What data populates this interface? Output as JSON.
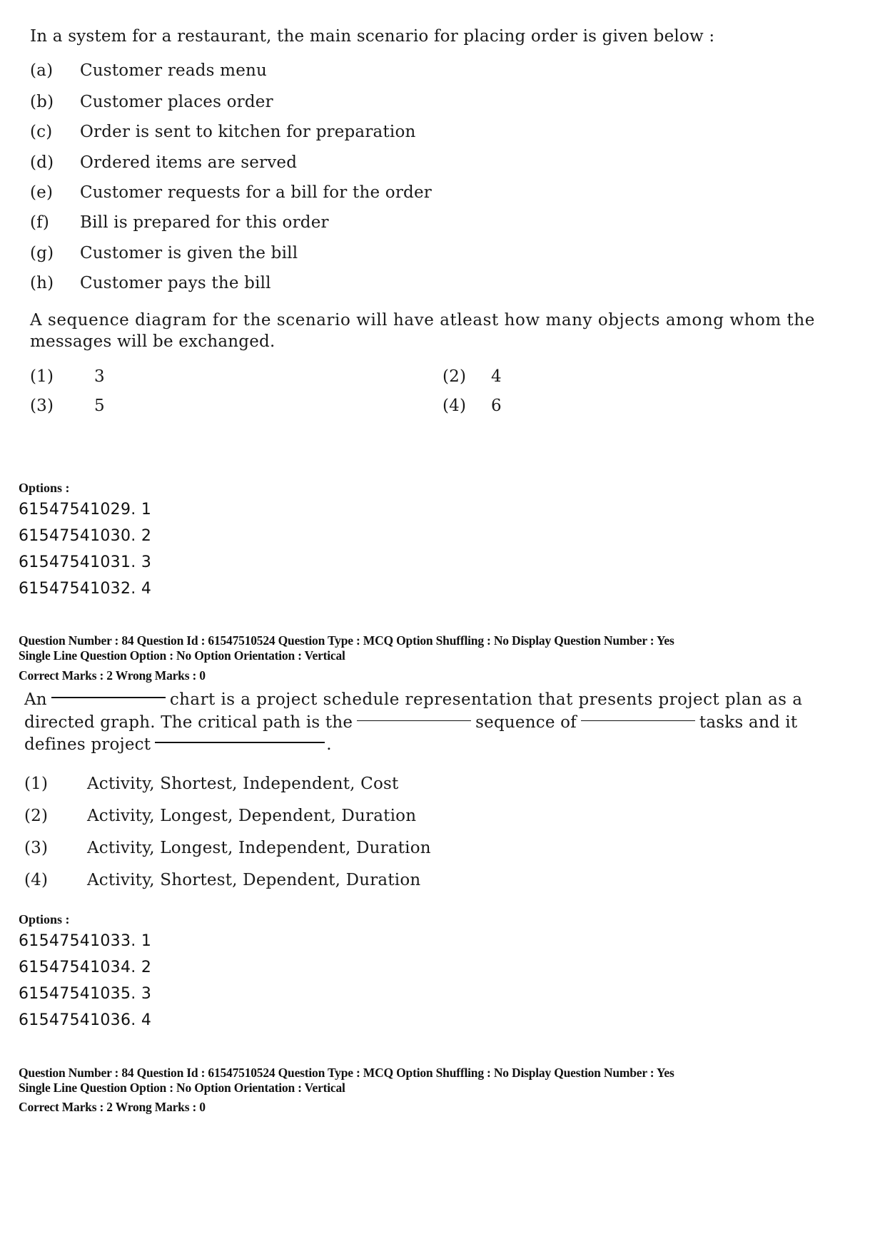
{
  "question1": {
    "intro": "In a system for a restaurant, the main scenario for placing order is given below :",
    "steps": [
      {
        "label": "(a)",
        "text": "Customer reads menu"
      },
      {
        "label": "(b)",
        "text": "Customer places order"
      },
      {
        "label": "(c)",
        "text": "Order is sent to kitchen for preparation"
      },
      {
        "label": "(d)",
        "text": "Ordered items are served"
      },
      {
        "label": "(e)",
        "text": "Customer requests for a bill for the order"
      },
      {
        "label": "(f)",
        "text": "Bill is prepared for this order"
      },
      {
        "label": "(g)",
        "text": "Customer is given the bill"
      },
      {
        "label": "(h)",
        "text": "Customer pays the bill"
      }
    ],
    "prompt_line1": "A sequence diagram for the scenario will have atleast how many objects among whom the",
    "prompt_line2": "messages will be exchanged.",
    "choices": [
      {
        "label": "(1)",
        "text": "3"
      },
      {
        "label": "(2)",
        "text": "4"
      },
      {
        "label": "(3)",
        "text": "5"
      },
      {
        "label": "(4)",
        "text": "6"
      }
    ],
    "options_header": "Options :",
    "option_ids": [
      "61547541029. 1",
      "61547541030. 2",
      "61547541031. 3",
      "61547541032. 4"
    ]
  },
  "question2_meta": {
    "line1": "Question Number : 84  Question Id : 61547510524  Question Type : MCQ  Option Shuffling : No  Display Question Number : Yes",
    "line2": "Single Line Question Option : No  Option Orientation : Vertical",
    "marks": "Correct Marks : 2  Wrong Marks : 0"
  },
  "question2": {
    "seg_an": "An",
    "seg_1": "chart is a project schedule representation  that presents project plan as a",
    "seg_2": "directed graph. The critical path is the",
    "seg_3": "sequence of",
    "seg_4": "tasks and it",
    "seg_5": "defines project",
    "seg_end": ".",
    "choices": [
      {
        "label": "(1)",
        "text": "Activity, Shortest, Independent, Cost"
      },
      {
        "label": "(2)",
        "text": "Activity, Longest, Dependent, Duration"
      },
      {
        "label": "(3)",
        "text": "Activity, Longest, Independent, Duration"
      },
      {
        "label": "(4)",
        "text": "Activity, Shortest, Dependent, Duration"
      }
    ],
    "options_header": "Options :",
    "option_ids": [
      "61547541033. 1",
      "61547541034. 2",
      "61547541035. 3",
      "61547541036. 4"
    ]
  },
  "question3_meta": {
    "line1": "Question Number : 84  Question Id : 61547510524  Question Type : MCQ  Option Shuffling : No  Display Question Number : Yes",
    "line2": "Single Line Question Option : No  Option Orientation : Vertical",
    "marks": "Correct Marks : 2  Wrong Marks : 0"
  }
}
